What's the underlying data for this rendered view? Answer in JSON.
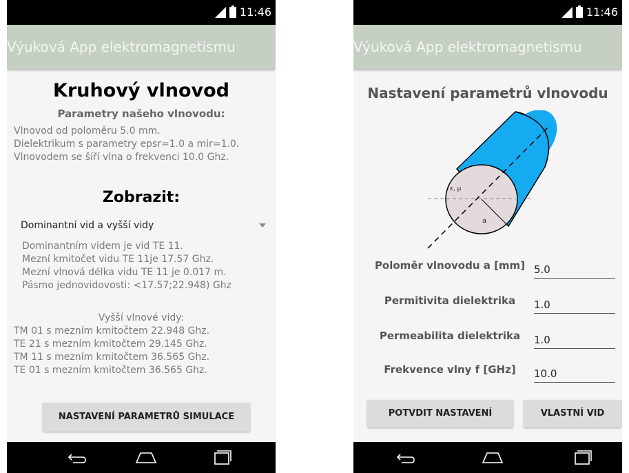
{
  "status": {
    "time": "11:46",
    "network": "4G"
  },
  "app_title": "Výuková App elektromagnetismu",
  "left": {
    "title": "Kruhový vlnovod",
    "subtitle": "Parametry našeho vlnovodu:",
    "params": [
      "Vlnovod od poloměru 5.0 mm.",
      "Dielektrikum s parametry epsr=1.0 a mir=1.0.",
      "Vlnovodem se šíří vlna o frekvenci 10.0 Ghz."
    ],
    "show_heading": "Zobrazit:",
    "dropdown_value": "Dominantní vid a vyšší vidy",
    "dominant": [
      "Dominantním videm je vid TE 11.",
      "Mezní kmitočet vidu TE 11je 17.57 Ghz.",
      "Mezní vlnová délka vidu TE 11 je 0.017 m.",
      "Pásmo jednovidovosti: <17.57;22.948) Ghz"
    ],
    "higher_heading": "Vyšší vlnové vidy:",
    "higher": [
      "TM 01 s mezním kmitočtem 22.948 Ghz.",
      "TE 21 s mezním kmitočtem 29.145 Ghz.",
      "TM 11 s mezním kmitočtem 36.565 Ghz.",
      "TE 01 s mezním kmitočtem 36.565 Ghz."
    ],
    "button": "NASTAVENÍ PARAMETRŮ SIMULACE"
  },
  "right": {
    "title": "Nastavení parametrů vlnovodu",
    "diagram": {
      "eps_mu": "ε, μ",
      "radius": "a"
    },
    "fields": [
      {
        "label": "Poloměr vlnovodu a [mm]",
        "value": "5.0"
      },
      {
        "label": "Permitivita dielektrika",
        "value": "1.0"
      },
      {
        "label": "Permeabilita dielektrika",
        "value": "1.0"
      },
      {
        "label": "Frekvence vlny f [GHz]",
        "value": "10.0"
      }
    ],
    "confirm_button": "POTVDIT NASTAVENÍ",
    "custom_button": "VLASTNÍ VID"
  },
  "colors": {
    "appbar": "#c5cfc3",
    "cylinder": "#16aaf0",
    "face": "#e3dbdb"
  }
}
